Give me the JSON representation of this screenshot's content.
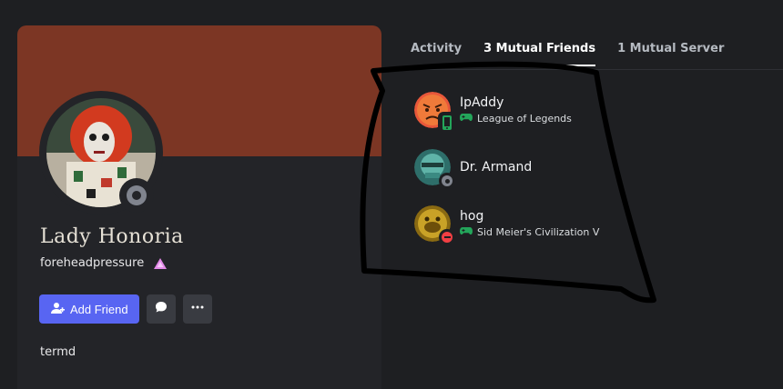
{
  "profile": {
    "display_name": "Lady Honoria",
    "username": "foreheadpressure",
    "about": "termd",
    "status": "offline",
    "banner_color": "#7c3624",
    "accent_color": "#5865f2",
    "badge_icon": "nitro-triangle-icon"
  },
  "actions": {
    "add_friend_label": "Add Friend",
    "add_friend_icon": "add-user-icon",
    "message_icon": "message-bubble-icon",
    "more_icon": "more-dots-icon"
  },
  "tabs": [
    {
      "label": "Activity",
      "active": false
    },
    {
      "label": "3 Mutual Friends",
      "active": true
    },
    {
      "label": "1 Mutual Server",
      "active": false
    }
  ],
  "mutual_friends": [
    {
      "name": "IpAddy",
      "activity": "League of Legends",
      "status": "online-mobile",
      "status_color": "#23a55a"
    },
    {
      "name": "Dr. Armand",
      "activity": "",
      "status": "offline",
      "status_color": "#80848e"
    },
    {
      "name": "hog",
      "activity": "Sid Meier's Civilization V",
      "status": "dnd",
      "status_color": "#f23f43"
    }
  ]
}
